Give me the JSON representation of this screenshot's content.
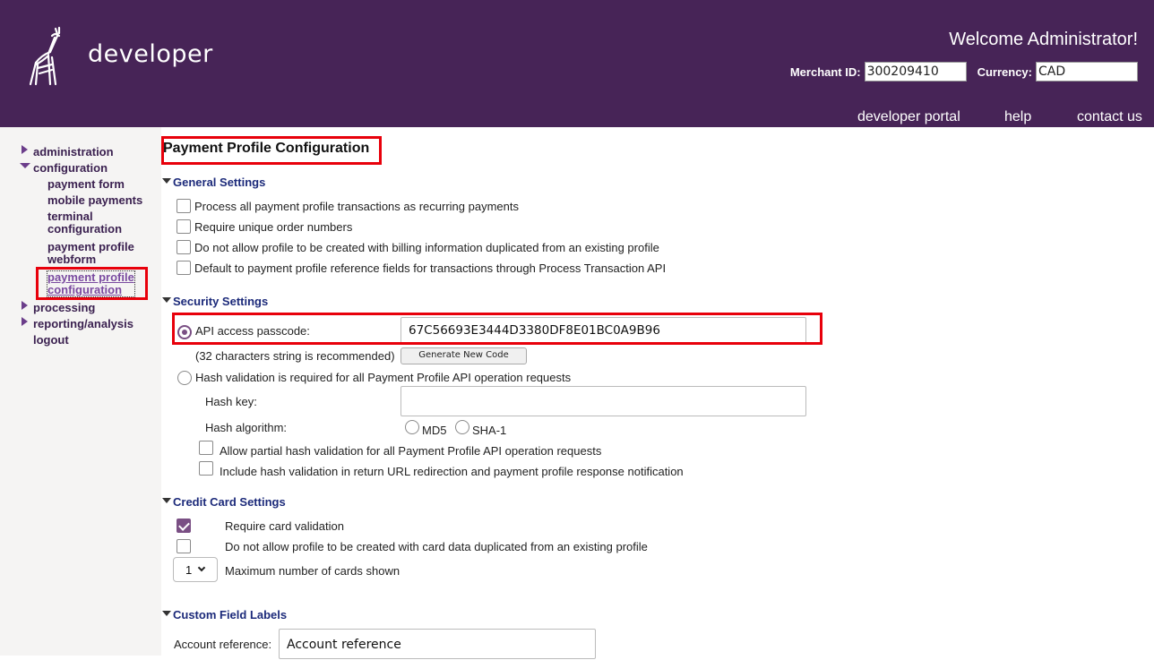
{
  "header": {
    "logo_text": "developer",
    "welcome": "Welcome Administrator!",
    "merchant_label": "Merchant ID:",
    "merchant_id": "300209410",
    "currency_label": "Currency:",
    "currency": "CAD",
    "links": [
      "developer portal",
      "help",
      "contact us"
    ],
    "bg_color": "#472457"
  },
  "sidebar": {
    "administration": "administration",
    "configuration": "configuration",
    "sub": {
      "payment_form": "payment form",
      "mobile_payments": "mobile payments",
      "terminal_line1": "terminal",
      "terminal_line2": "configuration",
      "webform_line1": "payment profile",
      "webform_line2": "webform",
      "config_line1": "payment profile",
      "config_line2": "configuration"
    },
    "processing": "processing",
    "reporting": "reporting/analysis",
    "logout": "logout"
  },
  "main": {
    "title": "Payment Profile Configuration",
    "general": {
      "heading": "General Settings",
      "opt1": "Process all payment profile transactions as recurring payments",
      "opt2": "Require unique order numbers",
      "opt3": "Do not allow profile to be created with billing information duplicated from an existing profile",
      "opt4": "Default to payment profile reference fields for transactions through Process Transaction API"
    },
    "security": {
      "heading": "Security Settings",
      "api_label": "API access passcode:",
      "api_value": "67C56693E3444D3380DF8E01BC0A9B96",
      "recommend": "(32 characters string is recommended)",
      "generate_button": "Generate New Code",
      "hash_required": "Hash validation is required for all Payment Profile API operation requests",
      "hash_key_label": "Hash key:",
      "hash_key_value": "",
      "hash_algo_label": "Hash algorithm:",
      "md5": "MD5",
      "sha1": "SHA-1",
      "partial_hash": "Allow partial hash validation for all Payment Profile API operation requests",
      "include_hash": "Include hash validation in return URL redirection and payment profile response notification"
    },
    "credit": {
      "heading": "Credit Card Settings",
      "require_validation": "Require card validation",
      "no_duplicate": "Do not allow profile to be created with card data duplicated from an existing profile",
      "max_cards_value": "1",
      "max_cards_label": "Maximum number of cards shown"
    },
    "custom": {
      "heading": "Custom Field Labels",
      "account_label": "Account reference:",
      "account_value": "Account reference"
    }
  },
  "colors": {
    "accent": "#7a4f84",
    "highlight": "#e8000b",
    "section_heading": "#1c2a7a"
  }
}
